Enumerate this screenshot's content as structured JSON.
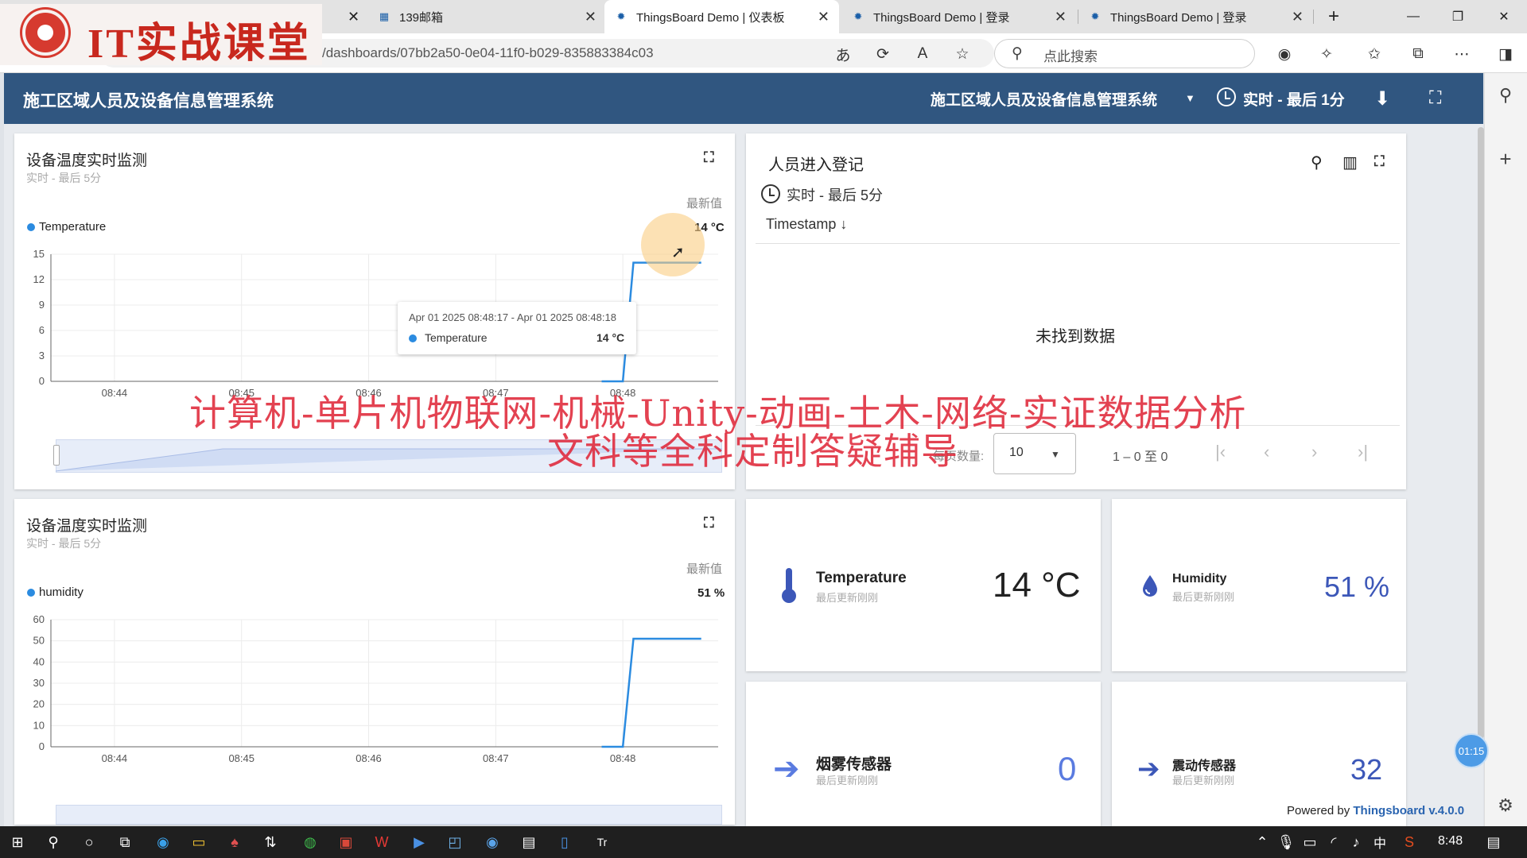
{
  "browser": {
    "tabs": [
      {
        "label": "139邮箱"
      },
      {
        "label": "ThingsBoard Demo | 仪表板",
        "active": true
      },
      {
        "label": "ThingsBoard Demo | 登录"
      },
      {
        "label": "ThingsBoard Demo | 登录"
      }
    ],
    "url": "/dashboards/07bb2a50-0e04-11f0-b029-835883384c03",
    "search_placeholder": "点此搜索"
  },
  "watermark": {
    "logo_text": "IT实战课堂",
    "line1": "计算机-单片机物联网-机械-Unity-动画-土木-网络-实证数据分析",
    "line2": "文科等全科定制答疑辅导"
  },
  "app": {
    "title": "施工区域人员及设备信息管理系统",
    "dashboard_select": "施工区域人员及设备信息管理系统",
    "time_window": "实时 - 最后 1分"
  },
  "charts": [
    {
      "title": "设备温度实时监测",
      "subtitle": "实时 - 最后 5分",
      "latest_header": "最新值",
      "legend": "Temperature",
      "latest_value": "14 °C",
      "tooltip": {
        "time": "Apr 01 2025 08:48:17 - Apr 01 2025 08:48:18",
        "series": "Temperature",
        "value": "14 °C"
      }
    },
    {
      "title": "设备温度实时监测",
      "subtitle": "实时 - 最后 5分",
      "latest_header": "最新值",
      "legend": "humidity",
      "latest_value": "51 %"
    }
  ],
  "chart_data": [
    {
      "type": "line",
      "series": [
        {
          "name": "Temperature",
          "color": "#2b8be0",
          "x": [
            "08:47:50",
            "08:48:00",
            "08:48:05",
            "08:48:17",
            "08:48:30",
            "08:48:37"
          ],
          "y": [
            0,
            0,
            14,
            14,
            14,
            14
          ]
        }
      ],
      "x_ticks": [
        "08:44",
        "08:45",
        "08:46",
        "08:47",
        "08:48"
      ],
      "y_ticks": [
        0,
        3,
        6,
        9,
        12,
        15
      ],
      "ylim": [
        0,
        15
      ]
    },
    {
      "type": "line",
      "series": [
        {
          "name": "humidity",
          "color": "#2b8be0",
          "x": [
            "08:47:50",
            "08:48:00",
            "08:48:05",
            "08:48:37"
          ],
          "y": [
            0,
            0,
            51,
            51
          ]
        }
      ],
      "x_ticks": [
        "08:44",
        "08:45",
        "08:46",
        "08:47",
        "08:48"
      ],
      "y_ticks": [
        0,
        10,
        20,
        30,
        40,
        50,
        60
      ],
      "ylim": [
        0,
        60
      ]
    }
  ],
  "table": {
    "title": "人员进入登记",
    "time_window": "实时 - 最后 5分",
    "column": "Timestamp",
    "empty_text": "未找到数据",
    "page_size_label": "每页数量:",
    "page_size": "10",
    "range": "1 – 0 至 0"
  },
  "values": [
    {
      "label": "Temperature",
      "sub": "最后更新刚刚",
      "value": "14 °C",
      "icon": "thermometer-icon",
      "color": "#222222"
    },
    {
      "label": "Humidity",
      "sub": "最后更新刚刚",
      "value": "51 %",
      "icon": "water-drop-icon",
      "color": "#3c57b8"
    },
    {
      "label": "烟雾传感器",
      "sub": "最后更新刚刚",
      "value": "0",
      "icon": "arrow-right-icon",
      "color": "#5a7be0"
    },
    {
      "label": "震动传感器",
      "sub": "最后更新刚刚",
      "value": "32",
      "icon": "arrow-right-icon",
      "color": "#3c57b8"
    }
  ],
  "footer": {
    "powered_prefix": "Powered by ",
    "powered_brand": "Thingsboard v.4.0.0"
  },
  "timer": "01:15",
  "taskbar": {
    "clock": "8:48",
    "ime": "中"
  }
}
